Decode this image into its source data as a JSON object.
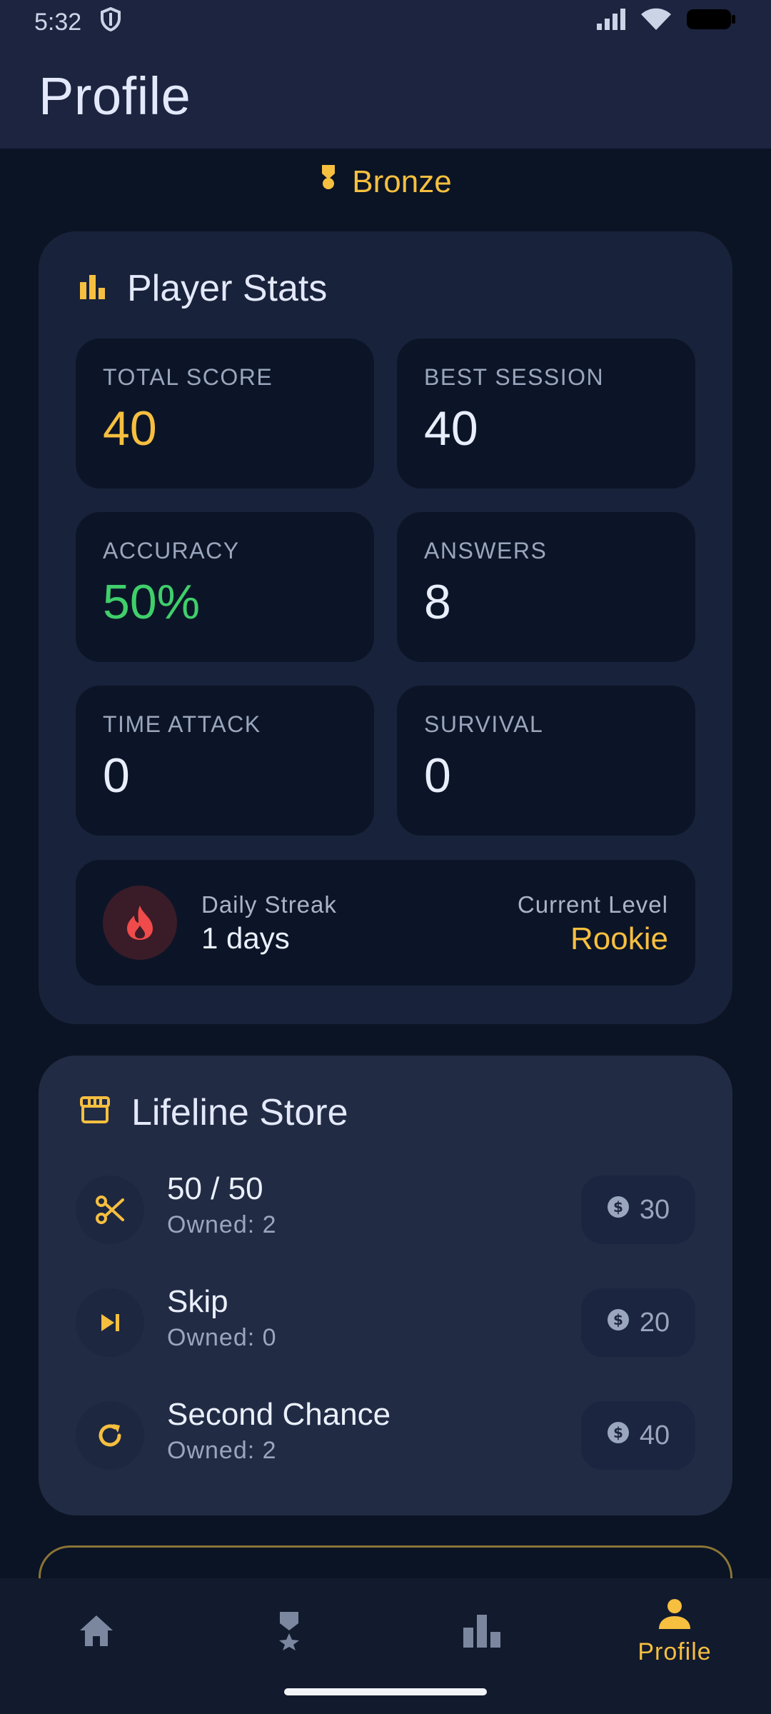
{
  "status_bar": {
    "time": "5:32",
    "icons": [
      "shield-icon",
      "signal-icon",
      "wifi-icon",
      "battery-icon"
    ]
  },
  "app_bar": {
    "title": "Profile"
  },
  "rank": {
    "label": "Bronze",
    "icon": "medal-icon"
  },
  "stats": {
    "title": "Player Stats",
    "icon": "bar-chart-icon",
    "tiles": [
      {
        "label": "TOTAL SCORE",
        "value": "40"
      },
      {
        "label": "BEST SESSION",
        "value": "40"
      },
      {
        "label": "ACCURACY",
        "value": "50%"
      },
      {
        "label": "ANSWERS",
        "value": "8"
      },
      {
        "label": "TIME ATTACK",
        "value": "0"
      },
      {
        "label": "SURVIVAL",
        "value": "0"
      }
    ],
    "streak": {
      "label": "Daily Streak",
      "value": "1 days",
      "level_label": "Current Level",
      "level_value": "Rookie"
    }
  },
  "store": {
    "title": "Lifeline Store",
    "icon": "store-icon",
    "items": [
      {
        "name": "50 / 50",
        "owned": "Owned: 2",
        "price": "30",
        "icon": "scissors-icon"
      },
      {
        "name": "Skip",
        "owned": "Owned: 0",
        "price": "20",
        "icon": "skip-next-icon"
      },
      {
        "name": "Second Chance",
        "owned": "Owned: 2",
        "price": "40",
        "icon": "refresh-icon"
      }
    ]
  },
  "nav": {
    "items": [
      {
        "name": "home",
        "icon": "home-icon"
      },
      {
        "name": "achievements",
        "icon": "medal-icon"
      },
      {
        "name": "leaderboard",
        "icon": "bar-chart-icon"
      },
      {
        "name": "profile",
        "icon": "person-icon",
        "label": "Profile",
        "active": true
      }
    ]
  },
  "colors": {
    "accent": "#f6bf3f",
    "success": "#3fcf6b",
    "background": "#0b1424",
    "card": "#18223a"
  }
}
